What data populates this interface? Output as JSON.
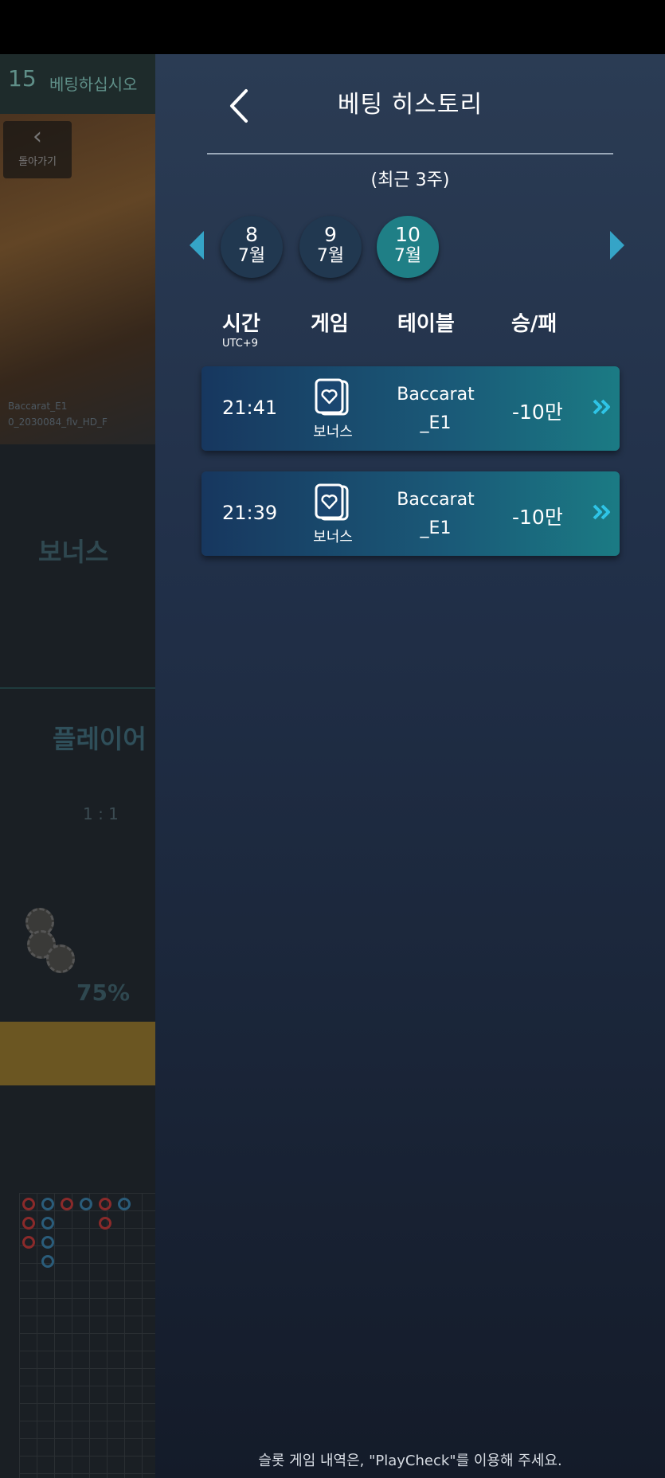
{
  "background": {
    "timer": "15",
    "prompt": "베팅하십시오",
    "back_label": "돌아가기",
    "table_id_line1": "Baccarat_E1",
    "table_id_line2": "0_2030084_flv_HD_F",
    "bonus_label": "보너스",
    "player_label": "플레이어",
    "odds": "1 : 1",
    "percent": "75%"
  },
  "panel": {
    "title": "베팅 히스토리",
    "subtitle": "(최근 3주)",
    "dates": [
      {
        "day": "8",
        "month": "7월",
        "active": false
      },
      {
        "day": "9",
        "month": "7월",
        "active": false
      },
      {
        "day": "10",
        "month": "7월",
        "active": true
      }
    ],
    "columns": {
      "time": "시간",
      "time_zone": "UTC+9",
      "game": "게임",
      "table": "테이블",
      "result": "승/패"
    },
    "rows": [
      {
        "time": "21:41",
        "game": "보너스",
        "table_line1": "Baccarat",
        "table_line2": "_E1",
        "result": "-10만"
      },
      {
        "time": "21:39",
        "game": "보너스",
        "table_line1": "Baccarat",
        "table_line2": "_E1",
        "result": "-10만"
      }
    ],
    "footer": "슬롯 게임 내역은, \"PlayCheck\"를 이용해 주세요."
  },
  "colors": {
    "accent": "#35a4c7",
    "active_date": "#1f7f86",
    "chevron": "#2ec4e6"
  }
}
